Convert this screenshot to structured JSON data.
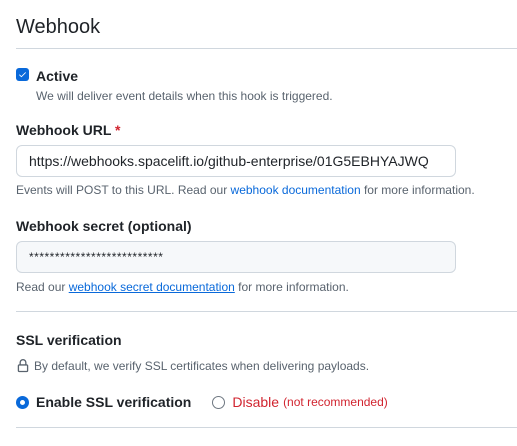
{
  "section": {
    "title": "Webhook"
  },
  "active": {
    "checked": true,
    "label": "Active",
    "note": "We will deliver event details when this hook is triggered."
  },
  "webhook_url": {
    "label": "Webhook URL",
    "required_mark": "*",
    "value": "https://webhooks.spacelift.io/github-enterprise/01G5EBHYAJWQ",
    "note_prefix": "Events will POST to this URL. Read our ",
    "note_link": "webhook documentation",
    "note_suffix": " for more information."
  },
  "webhook_secret": {
    "label": "Webhook secret (optional)",
    "value": "**************************",
    "note_prefix": "Read our ",
    "note_link": "webhook secret documentation",
    "note_suffix": " for more information."
  },
  "ssl": {
    "heading": "SSL verification",
    "note": "By default, we verify SSL certificates when delivering payloads.",
    "options": {
      "enable": {
        "label": "Enable SSL verification",
        "selected": true
      },
      "disable": {
        "label": "Disable",
        "hint": "(not recommended)",
        "selected": false
      }
    }
  },
  "icons": {
    "checkbox": "checkmark-icon",
    "lock": "lock-icon"
  },
  "colors": {
    "accent": "#0969da",
    "danger": "#d1242f",
    "muted": "#59636e",
    "border": "#d0d7de"
  }
}
